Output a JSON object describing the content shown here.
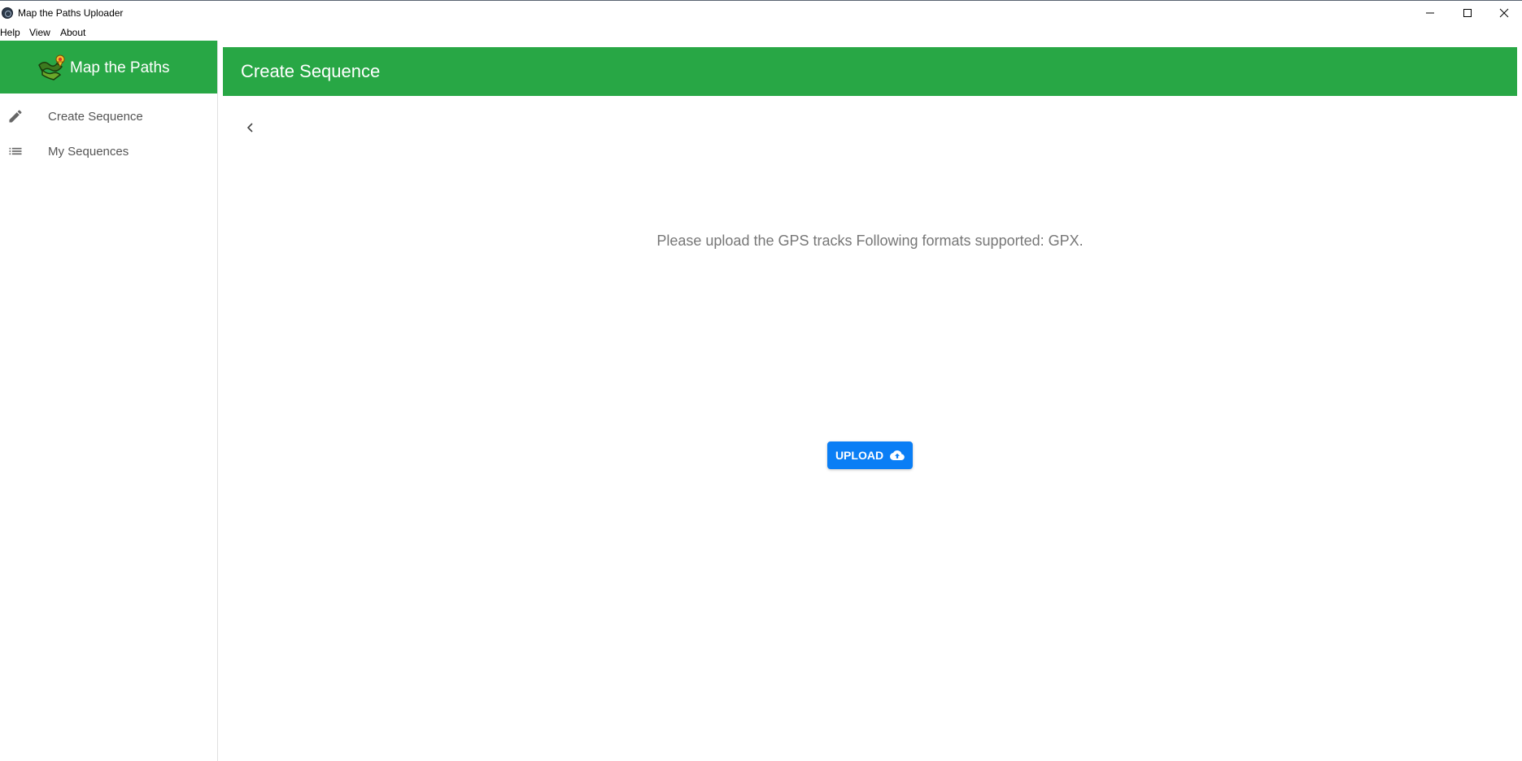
{
  "window": {
    "title": "Map the Paths Uploader",
    "minimize_icon": "minimize-icon",
    "maximize_icon": "maximize-icon",
    "close_icon": "close-icon"
  },
  "menu": [
    "Help",
    "View",
    "About"
  ],
  "sidebar": {
    "brand": "Map the Paths",
    "items": [
      {
        "label": "Create Sequence",
        "icon": "pencil-icon"
      },
      {
        "label": "My Sequences",
        "icon": "list-icon"
      }
    ]
  },
  "header": {
    "title": "Create Sequence"
  },
  "content": {
    "back_icon": "chevron-left-icon",
    "instructions": "Please upload the GPS tracks Following formats supported: GPX.",
    "upload_label": "UPLOAD",
    "upload_icon": "cloud-upload-icon"
  },
  "colors": {
    "brand_green": "#28a745",
    "upload_blue": "#0a7ef5"
  }
}
